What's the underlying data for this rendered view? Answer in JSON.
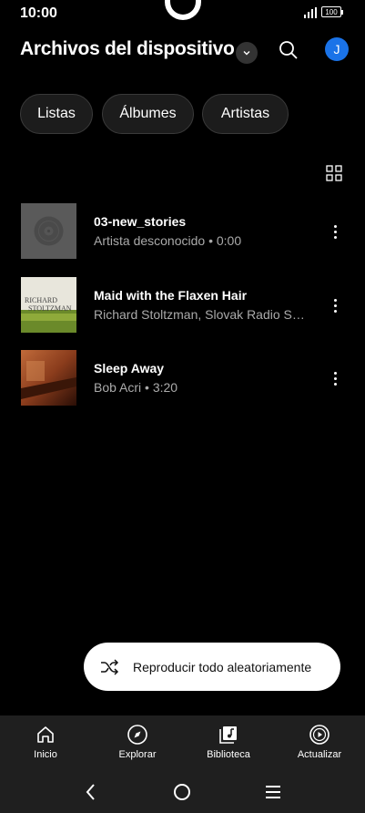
{
  "status": {
    "time": "10:00",
    "battery": "100"
  },
  "header": {
    "title": "Archivos del dispositivo",
    "avatar_letter": "J"
  },
  "chips": [
    {
      "label": "Listas"
    },
    {
      "label": "Álbumes"
    },
    {
      "label": "Artistas"
    }
  ],
  "songs": [
    {
      "title": "03-new_stories",
      "subtitle": "Artista desconocido • 0:00",
      "art": "placeholder"
    },
    {
      "title": "Maid with the Flaxen Hair",
      "subtitle": "Richard Stoltzman, Slovak Radio Symphony Orchestra",
      "art": "green-cover"
    },
    {
      "title": "Sleep Away",
      "subtitle": "Bob Acri • 3:20",
      "art": "piano-cover"
    }
  ],
  "cover_text": {
    "line1": "RICHARD",
    "line2": "STOLTZMAN"
  },
  "shuffle": {
    "label": "Reproducir todo aleatoriamente"
  },
  "nav": [
    {
      "label": "Inicio",
      "icon": "home-icon"
    },
    {
      "label": "Explorar",
      "icon": "compass-icon"
    },
    {
      "label": "Biblioteca",
      "icon": "library-icon"
    },
    {
      "label": "Actualizar",
      "icon": "upgrade-icon"
    }
  ],
  "colors": {
    "accent": "#1a73e8",
    "background": "#000000",
    "nav_bg": "#1f1f1f"
  }
}
